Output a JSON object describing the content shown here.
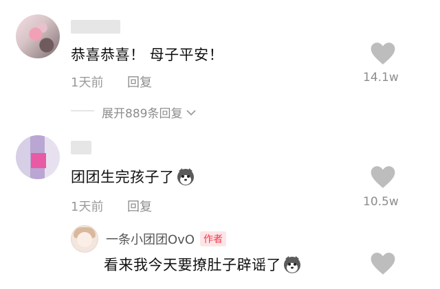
{
  "comments": [
    {
      "text": "恭喜恭喜！ 母子平安！",
      "time": "1天前",
      "reply_label": "回复",
      "likes": "14.1w",
      "expand_label": "展开889条回复"
    },
    {
      "text": "团团生完孩子了",
      "time": "1天前",
      "reply_label": "回复",
      "likes": "10.5w",
      "reply": {
        "author": "一条小团团OvO",
        "badge": "作者",
        "text": "看来我今天要撩肚子辟谣了"
      }
    }
  ],
  "icons": {
    "like": "heart-icon",
    "expand": "chevron-down-icon",
    "emoji": "husky-emoji-icon"
  },
  "colors": {
    "badge_text": "#ef3b4b",
    "badge_bg": "#fde5e7",
    "heart": "#bdbdbd"
  }
}
